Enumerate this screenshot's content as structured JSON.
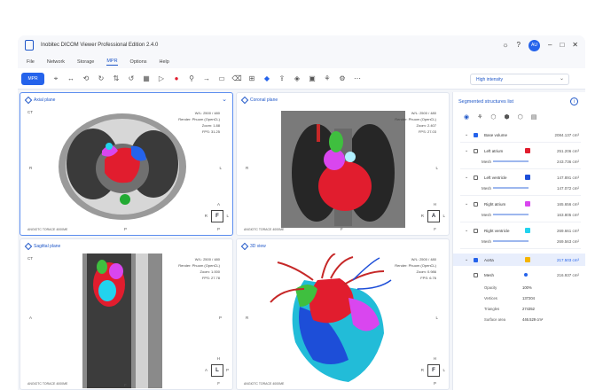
{
  "window": {
    "title": "Inobitec DICOM Viewer Professional Edition 2.4.0",
    "avatar": "AU"
  },
  "menu": [
    "File",
    "Network",
    "Storage",
    "MPR",
    "Options",
    "Help"
  ],
  "toolbar": {
    "mpr_label": "MPR",
    "intensity_dropdown": "High intensity"
  },
  "viewports": {
    "axial": {
      "title": "Axial plane",
      "ct": "CT",
      "wl": "W/L: 2500 / 480",
      "render": "Render: Phuom (OpenCL)",
      "zoom": "Zoom: 1.88",
      "fps": "FPS: 31.25",
      "left": "R",
      "right": "L",
      "bottom": "P",
      "cube_top": "A",
      "cube_left": "R",
      "cube_center": "F",
      "cube_right": "L",
      "cube_bottom": "P",
      "footer": "ANGIOTC TORACE 4000ME"
    },
    "coronal": {
      "title": "Coronal plane",
      "wl": "W/L: 2500 / 480",
      "render": "Render: Phuom (OpenCL)",
      "zoom": "Zoom: 2.407",
      "fps": "FPS: 27.03",
      "left": "R",
      "right": "L",
      "bottom": "F",
      "cube_top": "H",
      "cube_left": "R",
      "cube_center": "A",
      "cube_right": "L",
      "cube_bottom": "F",
      "footer": "ANGIOTC TORACE 4000ME"
    },
    "sagittal": {
      "title": "Sagittal plane",
      "ct": "CT",
      "wl": "W/L: 2500 / 480",
      "render": "Render: Phuom (OpenCL)",
      "zoom": "Zoom: 1.000",
      "fps": "FPS: 27.78",
      "left": "A",
      "right": "P",
      "bottom": "F",
      "cube_top": "H",
      "cube_left": "A",
      "cube_center": "L",
      "cube_right": "P",
      "cube_bottom": "F",
      "footer": "ANGIOTC TORACE 4000ME"
    },
    "view3d": {
      "title": "3D view",
      "wl": "W/L: 2500 / 480",
      "render": "Render: Phuom (OpenCL)",
      "zoom": "Zoom: 0.986",
      "fps": "FPS: 6.76",
      "left": "R",
      "right": "L",
      "cube_top": "H",
      "cube_left": "R",
      "cube_center": "F",
      "cube_right": "L",
      "cube_bottom": "P",
      "footer": "ANGIOTC TORACE 4000ME"
    }
  },
  "panel": {
    "title": "Segmented structures list",
    "items": [
      {
        "name": "Base volume",
        "value": "2084.137 cm³",
        "color": "#2563eb"
      },
      {
        "name": "Left atrium",
        "value": "251.206 cm³",
        "color": "#e11d2e"
      },
      {
        "name": "Mesh",
        "value": "243.736 cm²"
      },
      {
        "name": "Left ventricle",
        "value": "147.891 cm³",
        "color": "#1d4ed8"
      },
      {
        "name": "Mesh",
        "value": "147.072 cm²"
      },
      {
        "name": "Right atrium",
        "value": "165.656 cm³",
        "color": "#d946ef"
      },
      {
        "name": "Mesh",
        "value": "163.805 cm²"
      },
      {
        "name": "Right ventricle",
        "value": "269.661 cm³",
        "color": "#22d3ee"
      },
      {
        "name": "Mesh",
        "value": "269.563 cm²"
      },
      {
        "name": "Aorta",
        "value": "217.503 cm³",
        "color": "#f5b400"
      },
      {
        "name": "Mesh",
        "value": "216.937 cm²"
      }
    ],
    "props": [
      {
        "label": "Opacity",
        "value": "100%"
      },
      {
        "label": "Vertices",
        "value": "137204"
      },
      {
        "label": "Triangles",
        "value": "274352"
      },
      {
        "label": "Surface area",
        "value": "446.529 cm²"
      }
    ]
  }
}
